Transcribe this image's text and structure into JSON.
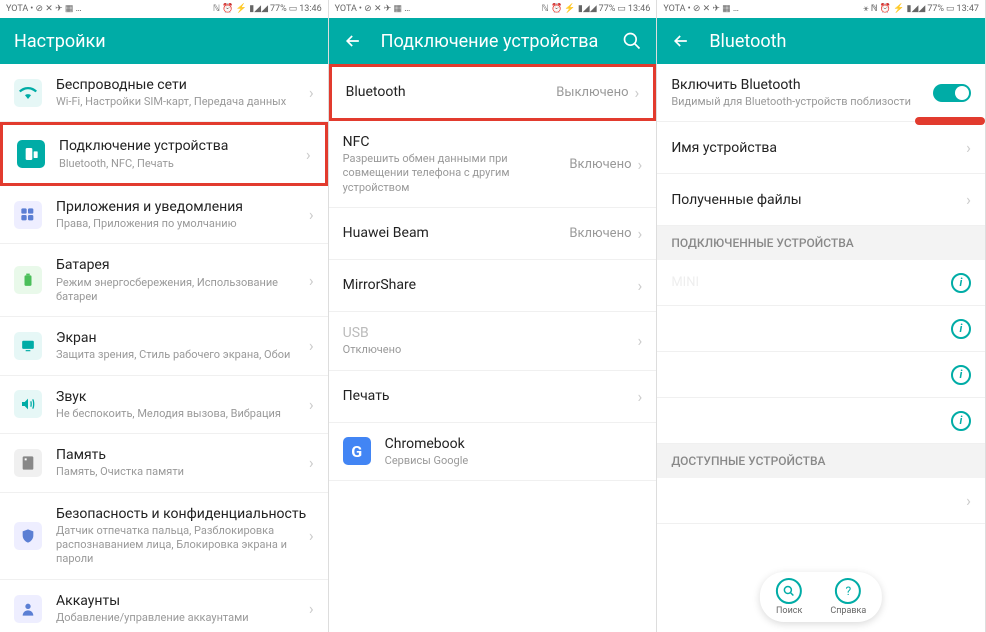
{
  "status": {
    "carrier": "YOTA",
    "battery": "77%",
    "time1": "13:46",
    "time2": "13:46",
    "time3": "13:47"
  },
  "screen1": {
    "title": "Настройки",
    "items": [
      {
        "title": "Беспроводные сети",
        "sub": "Wi-Fi, Настройки SIM-карт, Передача данных"
      },
      {
        "title": "Подключение устройства",
        "sub": "Bluetooth, NFC, Печать"
      },
      {
        "title": "Приложения и уведомления",
        "sub": "Права, Приложения по умолчанию"
      },
      {
        "title": "Батарея",
        "sub": "Режим энергосбережения, Использование батареи"
      },
      {
        "title": "Экран",
        "sub": "Защита зрения, Стиль рабочего экрана, Обои"
      },
      {
        "title": "Звук",
        "sub": "Не беспокоить, Мелодия вызова, Вибрация"
      },
      {
        "title": "Память",
        "sub": "Память, Очистка памяти"
      },
      {
        "title": "Безопасность и конфиденциальность",
        "sub": "Датчик отпечатка пальца, Разблокировка распознаванием лица, Блокировка экрана и пароли"
      },
      {
        "title": "Аккаунты",
        "sub": "Добавление/управление аккаунтами"
      }
    ]
  },
  "screen2": {
    "title": "Подключение устройства",
    "items": [
      {
        "title": "Bluetooth",
        "value": "Выключено"
      },
      {
        "title": "NFC",
        "sub": "Разрешить обмен данными при совмещении телефона с другим устройством",
        "value": "Включено"
      },
      {
        "title": "Huawei Beam",
        "value": "Включено"
      },
      {
        "title": "MirrorShare"
      },
      {
        "title": "USB",
        "sub": "Отключено"
      },
      {
        "title": "Печать"
      },
      {
        "title": "Chromebook",
        "sub": "Сервисы Google"
      }
    ]
  },
  "screen3": {
    "title": "Bluetooth",
    "enable": {
      "title": "Включить Bluetooth",
      "sub": "Видимый для Bluetooth-устройств поблизости"
    },
    "device_name": "Имя устройства",
    "received": "Полученные файлы",
    "section_paired": "ПОДКЛЮЧЕННЫЕ УСТРОЙСТВА",
    "section_available": "ДОСТУПНЫЕ УСТРОЙСТВА",
    "paired": [
      "MINI",
      " ",
      " ",
      " "
    ],
    "fab": {
      "search": "Поиск",
      "help": "Справка"
    }
  }
}
